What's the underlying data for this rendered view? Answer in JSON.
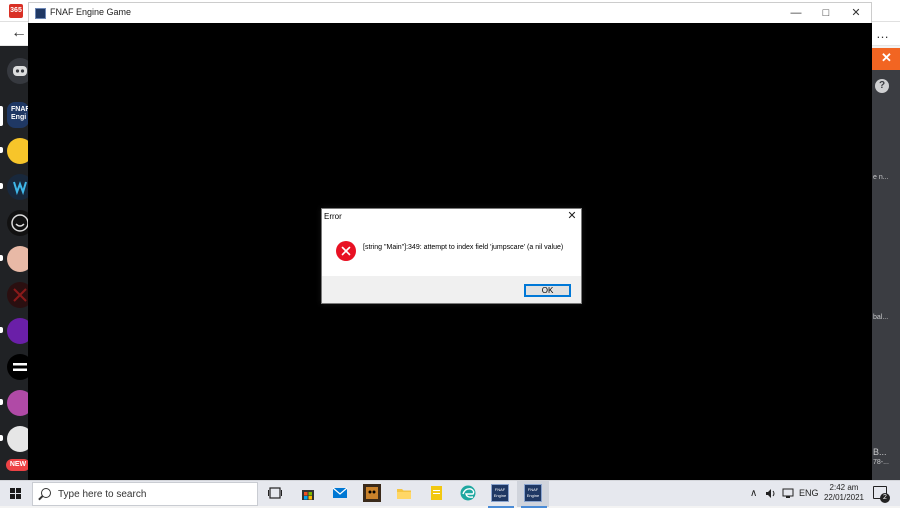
{
  "window": {
    "title": "FNAF Engine Game",
    "minimize_glyph": "—",
    "maximize_glyph": "□",
    "close_glyph": "✕"
  },
  "dialog": {
    "title": "Error",
    "close_glyph": "✕",
    "message": "[string \"Main\"]:349: attempt to index field 'jumpscare' (a nil value)",
    "ok_label": "OK",
    "icon": "error-icon"
  },
  "background": {
    "favicon_label": "365",
    "back_glyph": "←",
    "more_glyph": "…",
    "help_glyph": "?",
    "rail_new_badge": "NEW",
    "rail_fnaf_label": "FNAF Engi",
    "snippets": [
      "e n...",
      "bal...",
      "B...",
      "78-..."
    ]
  },
  "taskbar": {
    "search_placeholder": "Type here to search",
    "tray_language": "ENG",
    "tray_chevron": "∧",
    "clock_time": "2:42 am",
    "clock_date": "22/01/2021",
    "notification_count": "2",
    "fnaf_label": "FNAF Engine",
    "fnaf_label_2": "FNAF Engine"
  },
  "colors": {
    "error_red": "#e81123",
    "accent_blue": "#0078d7",
    "game_bg": "#000000",
    "rail_bg": "#202225"
  }
}
